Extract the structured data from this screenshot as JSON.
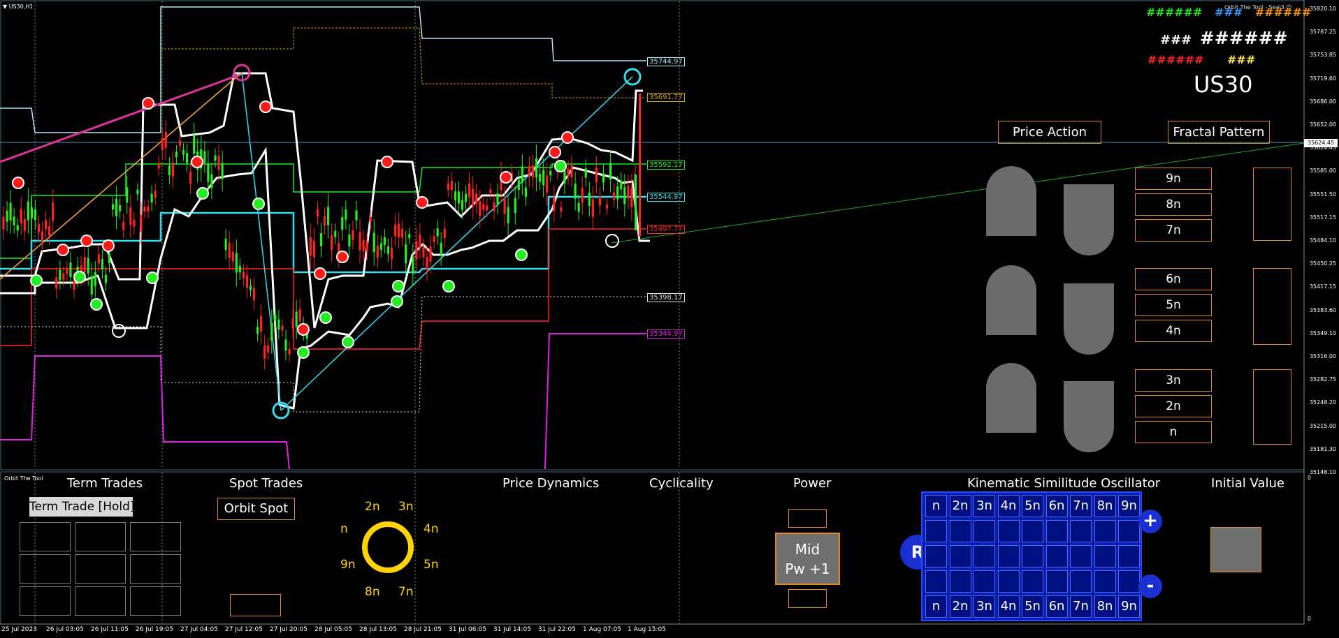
{
  "window": {
    "symbol_tf": "US30,H1",
    "indicator_name": "Orbit The Tool - Seal3 ☺",
    "subwindow_name": "Orbit The Tool"
  },
  "colors": {
    "background": "#000000",
    "accent_orange": "#e08a1e",
    "hash_green": "#22ee22",
    "hash_blue": "#3399ff",
    "hash_orange": "#ff9900",
    "hash_red": "#ff2222",
    "hash_yellow": "#ffee55",
    "cycle_yellow": "#ffd400",
    "kinematic_blue": "#0b1fa8"
  },
  "legend": {
    "row1": [
      {
        "text": "######",
        "color": "#22ee22"
      },
      {
        "text": "###",
        "color": "#3399ff"
      },
      {
        "text": "######",
        "color": "#ff9900"
      }
    ],
    "row2": [
      {
        "text": "###",
        "color": "#ffffff"
      },
      {
        "text": "######",
        "color": "#ffffff"
      }
    ],
    "row3": [
      {
        "text": "######",
        "color": "#ff2222"
      },
      {
        "text": "###",
        "color": "#ffee55"
      }
    ],
    "symbol": "US30"
  },
  "pattern_panel": {
    "price_action": "Price Action",
    "fractal_pattern": "Fractal Pattern",
    "groups": [
      [
        "9n",
        "8n",
        "7n"
      ],
      [
        "6n",
        "5n",
        "4n"
      ],
      [
        "3n",
        "2n",
        "n"
      ]
    ]
  },
  "price_levels": [
    {
      "value": "35744.97",
      "color": "#aee8f0"
    },
    {
      "value": "35691.77",
      "color": "#d4a300"
    },
    {
      "value": "35592.17",
      "color": "#22ee22"
    },
    {
      "value": "35544.97",
      "color": "#33ddee"
    },
    {
      "value": "35497.77",
      "color": "#ff2222"
    },
    {
      "value": "35398.17",
      "color": "#dddddd"
    },
    {
      "value": "35344.97",
      "color": "#e020e0"
    }
  ],
  "y_axis": {
    "labels": [
      "35820.10",
      "35787.25",
      "35753.85",
      "35719.60",
      "35686.00",
      "35652.00",
      "35624.45",
      "35585.00",
      "35551.50",
      "35517.15",
      "35484.10",
      "35450.25",
      "35417.15",
      "35383.60",
      "35349.10",
      "35316.00",
      "35282.75",
      "35248.20",
      "35215.00",
      "35181.30",
      "35148.10"
    ],
    "current_price": "35624.45",
    "sub_top": "0",
    "sub_bottom": "0"
  },
  "x_axis": {
    "labels": [
      "25 Jul 2023",
      "26 Jul 03:05",
      "26 Jul 11:05",
      "26 Jul 19:05",
      "27 Jul 04:05",
      "27 Jul 12:05",
      "27 Jul 20:05",
      "28 Jul 05:05",
      "28 Jul 13:05",
      "28 Jul 21:05",
      "31 Jul 06:05",
      "31 Jul 14:05",
      "31 Jul 22:05",
      "1 Aug 07:05",
      "1 Aug 15:05"
    ]
  },
  "bottom_panel": {
    "term_trades": "Term Trades",
    "term_trade_button": "Term Trade [Hold]",
    "spot_trades": "Spot Trades",
    "orbit_spot": "Orbit Spot",
    "price_dynamics": "Price Dynamics",
    "cyclicality": "Cyclicality",
    "power": "Power",
    "power_button_line1": "Mid",
    "power_button_line2": "Pw +1",
    "kinematic": "Kinematic Similitude Oscillator",
    "initial_value": "Initial Value",
    "cycle_labels": [
      "2n",
      "3n",
      "n",
      "4n",
      "9n",
      "5n",
      "8n",
      "7n"
    ],
    "kinematic_labels": [
      "n",
      "2n",
      "3n",
      "4n",
      "5n",
      "6n",
      "7n",
      "8n",
      "9n"
    ],
    "reset": "R",
    "plus": "+",
    "minus": "-"
  }
}
